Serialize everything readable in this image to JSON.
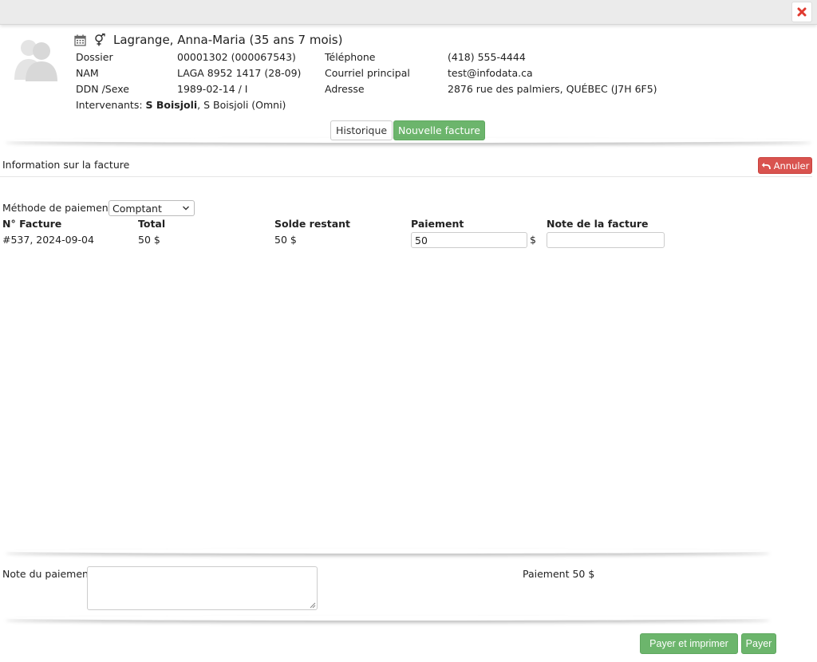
{
  "window": {
    "close_icon": "close-x-icon",
    "accent_close": "#e03a2f"
  },
  "patient": {
    "name": "Lagrange, Anna-Maria (35 ans 7 mois)",
    "avatar_icon": "user-group-icon",
    "calendar_icon": "calendar-icon",
    "gender_icon": "gender-icon",
    "left_fields": [
      {
        "label": "Dossier",
        "value": "00001302 (000067543)"
      },
      {
        "label": "NAM",
        "value": "LAGA 8952 1417 (28-09)"
      },
      {
        "label": "DDN /Sexe",
        "value": "1989-02-14 / I"
      }
    ],
    "right_fields": [
      {
        "label": "Téléphone",
        "value": "(418) 555-4444"
      },
      {
        "label": "Courriel principal",
        "value": "test@infodata.ca"
      },
      {
        "label": "Adresse",
        "value": "2876 rue des palmiers, QUÉBEC (J7H 6F5)"
      }
    ],
    "intervenants_label": "Intervenants: ",
    "intervenant_primary": "S Boisjoli",
    "intervenant_rest": ", S Boisjoli (Omni)"
  },
  "tabs": {
    "historique": "Historique",
    "nouvelle_facture": "Nouvelle facture"
  },
  "invoice_info": {
    "title": "Information sur la facture",
    "cancel_label": "Annuler",
    "cancel_color": "#d9534f"
  },
  "payment_method": {
    "label": "Méthode de paiement",
    "selected": "Comptant"
  },
  "table": {
    "headers": [
      "N° Facture",
      "Total",
      "Solde restant",
      "Paiement",
      "Note de la facture"
    ],
    "rows": [
      {
        "numero": "#537, 2024-09-04",
        "total": "50 $",
        "solde": "50 $",
        "paiement": "50",
        "currency": "$",
        "note": ""
      }
    ]
  },
  "footer": {
    "note_label": "Note du paiement",
    "note_value": "",
    "summary": "Paiement 50 $",
    "pay_print_label": "Payer et imprimer",
    "pay_label": "Payer",
    "button_color": "#6cb56c"
  }
}
